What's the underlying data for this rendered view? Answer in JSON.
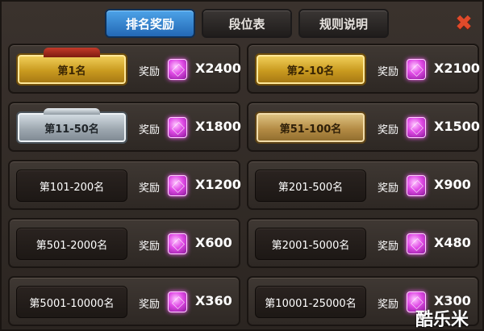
{
  "tabs": [
    {
      "label": "排名奖励",
      "active": true
    },
    {
      "label": "段位表",
      "active": false
    },
    {
      "label": "规则说明",
      "active": false
    }
  ],
  "close_icon": "close-icon",
  "reward_label": "奖励",
  "gem_icon": "gem-icon",
  "rewards": [
    {
      "rank": "第1名",
      "amount": "X2400",
      "style": "gold"
    },
    {
      "rank": "第2-10名",
      "amount": "X2100",
      "style": "gold"
    },
    {
      "rank": "第11-50名",
      "amount": "X1800",
      "style": "silver"
    },
    {
      "rank": "第51-100名",
      "amount": "X1500",
      "style": "bronze"
    },
    {
      "rank": "第101-200名",
      "amount": "X1200",
      "style": "plain"
    },
    {
      "rank": "第201-500名",
      "amount": "X900",
      "style": "plain"
    },
    {
      "rank": "第501-2000名",
      "amount": "X600",
      "style": "plain"
    },
    {
      "rank": "第2001-5000名",
      "amount": "X480",
      "style": "plain"
    },
    {
      "rank": "第5001-10000名",
      "amount": "X360",
      "style": "plain"
    },
    {
      "rank": "第10001-25000名",
      "amount": "X300",
      "style": "plain"
    }
  ],
  "watermark": "酷乐米",
  "colors": {
    "active_tab": "#2f7fcf",
    "gold": "#d6a52a",
    "silver": "#a7b1b9",
    "bronze": "#b89550",
    "gem": "#e04ae6",
    "close": "#e04a2a"
  }
}
